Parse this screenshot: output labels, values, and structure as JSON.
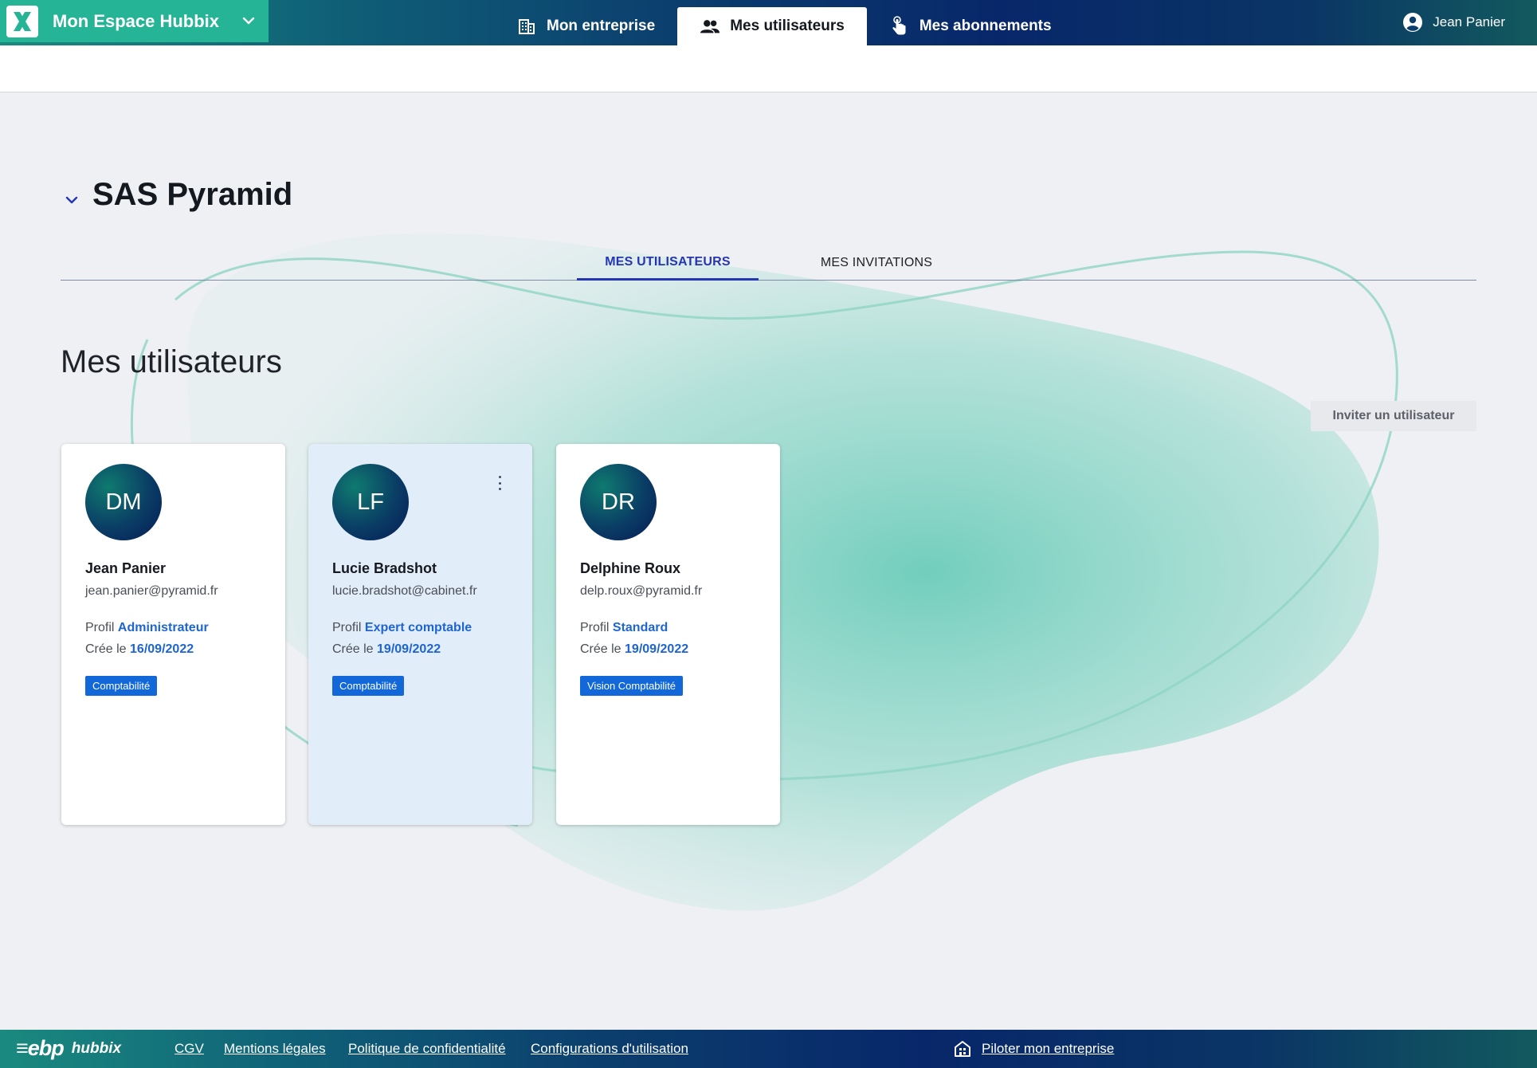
{
  "app": {
    "title": "Mon Espace Hubbix",
    "logo_icon": "hubbix-x-logo-icon"
  },
  "nav": {
    "tabs": [
      {
        "label": "Mon entreprise",
        "icon": "building-icon",
        "active": false
      },
      {
        "label": "Mes utilisateurs",
        "icon": "users-icon",
        "active": true
      },
      {
        "label": "Mes abonnements",
        "icon": "touch-pointer-icon",
        "active": false
      }
    ],
    "user_name": "Jean Panier"
  },
  "company": {
    "name": "SAS Pyramid"
  },
  "tabs": [
    {
      "label": "MES UTILISATEURS",
      "active": true
    },
    {
      "label": "MES INVITATIONS",
      "active": false
    }
  ],
  "section": {
    "title": "Mes utilisateurs",
    "invite_label": "Inviter un utilisateur"
  },
  "users": [
    {
      "initials": "DM",
      "name": "Jean Panier",
      "email": "jean.panier@pyramid.fr",
      "profile_label": "Profil",
      "profile_value": "Administrateur",
      "created_label": "Crée le",
      "created_value": "16/09/2022",
      "badge": "Comptabilité",
      "selected": false
    },
    {
      "initials": "LF",
      "name": "Lucie Bradshot",
      "email": "lucie.bradshot@cabinet.fr",
      "profile_label": "Profil",
      "profile_value": "Expert comptable",
      "created_label": "Crée le",
      "created_value": "19/09/2022",
      "badge": "Comptabilité",
      "selected": true
    },
    {
      "initials": "DR",
      "name": "Delphine Roux",
      "email": "delp.roux@pyramid.fr",
      "profile_label": "Profil",
      "profile_value": "Standard",
      "created_label": "Crée le",
      "created_value": "19/09/2022",
      "badge": "Vision Comptabilité",
      "selected": false
    }
  ],
  "footer": {
    "brand": "ebp",
    "brand_sub": "hubbix",
    "links": [
      "CGV",
      "Mentions légales",
      "Politique de confidentialité",
      "Configurations d'utilisation"
    ],
    "pilot_label": "Piloter mon entreprise"
  },
  "colors": {
    "brand_green": "#25b596",
    "accent_blue": "#2536b2",
    "link_blue": "#1e64d2",
    "badge_blue": "#1268d8",
    "selected_card": "#e2edfa",
    "page_bg": "#eff0f4"
  }
}
